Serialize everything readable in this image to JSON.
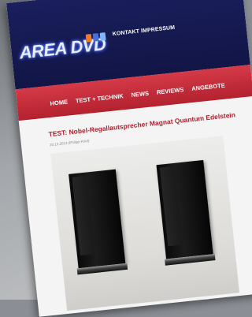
{
  "header": {
    "logo_text": "AREA DVD",
    "top_links": "KONTAKT IMPRESSUM",
    "social_icons": [
      "rss-icon",
      "facebook-icon",
      "twitter-icon"
    ]
  },
  "nav": {
    "items": [
      "HOME",
      "TEST + TECHNIK",
      "NEWS",
      "REVIEWS",
      "ANGEBOTE"
    ]
  },
  "article": {
    "title": "TEST: Nobel-Regallautsprecher Magnat Quantum Edelstein",
    "meta": "20.12.2013 (Philipp Kind)"
  },
  "colors": {
    "header_bg": "#1a1f5e",
    "nav_bg": "#c62d3b",
    "title_color": "#b7202e"
  }
}
